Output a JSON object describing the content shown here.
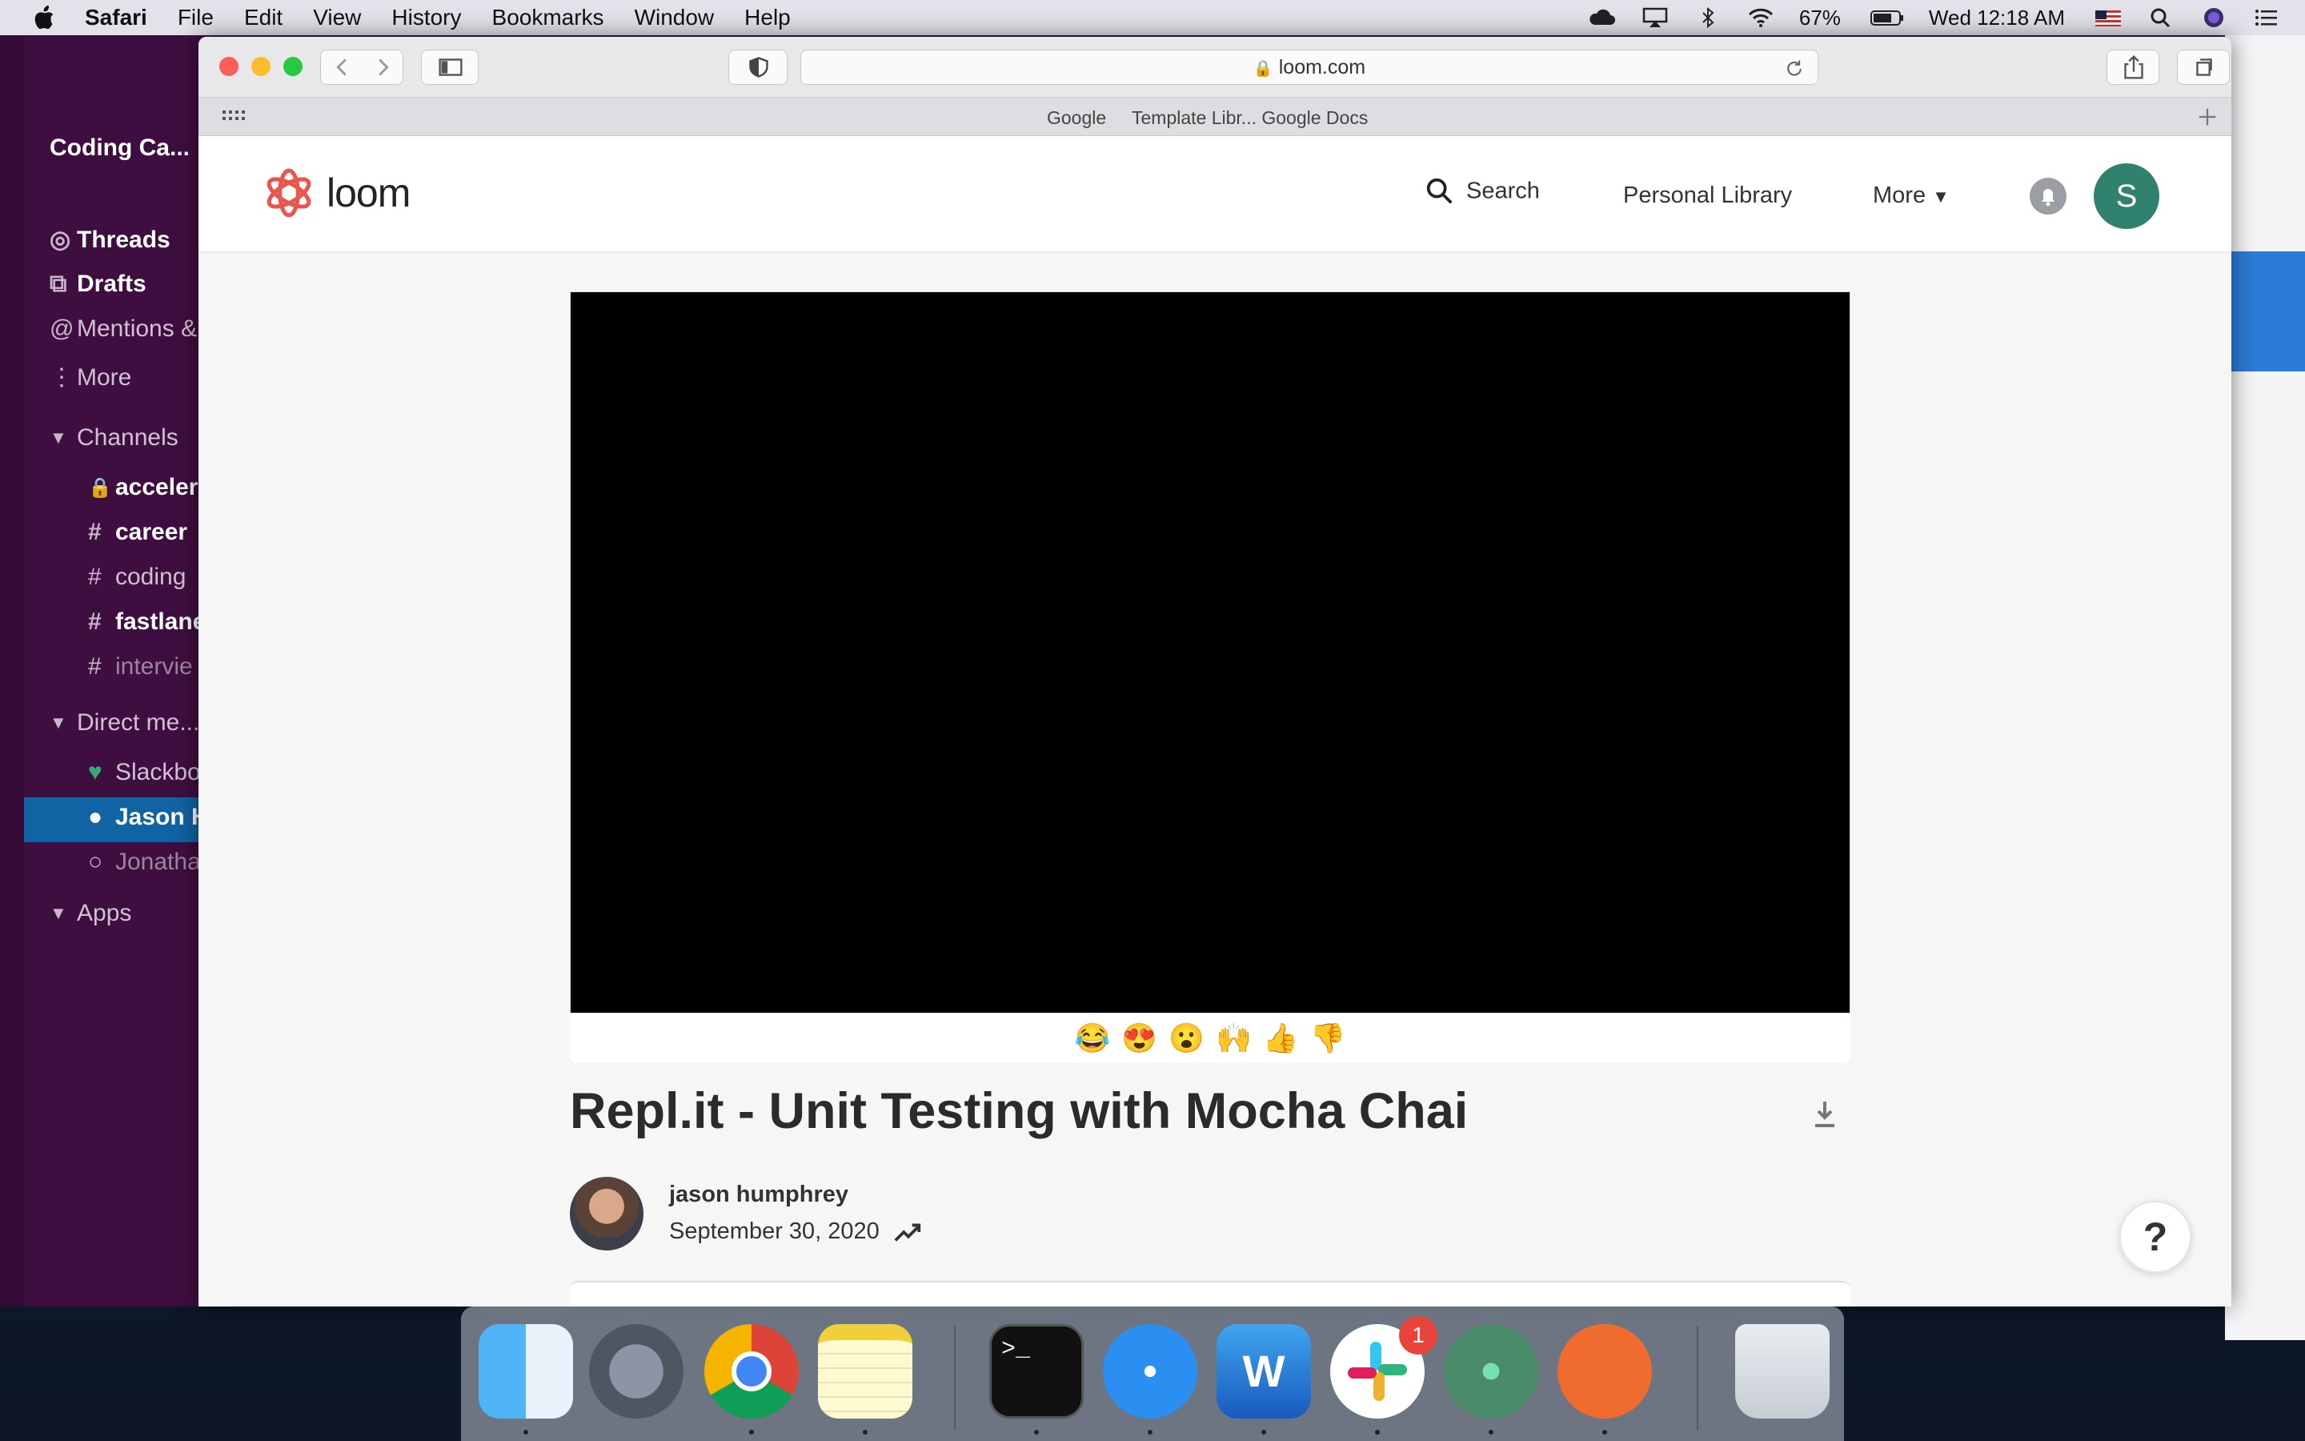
{
  "menubar": {
    "app": "Safari",
    "items": [
      "File",
      "Edit",
      "View",
      "History",
      "Bookmarks",
      "Window",
      "Help"
    ],
    "battery": "67%",
    "clock": "Wed 12:18 AM"
  },
  "slack": {
    "workspace": "Coding Ca...",
    "threads": "Threads",
    "drafts": "Drafts",
    "mentions": "Mentions &",
    "more": "More",
    "channels_header": "Channels",
    "channels": [
      "accelera",
      "career",
      "coding",
      "fastlane",
      "intervie"
    ],
    "dm_header": "Direct me...",
    "dms": [
      "Slackbo",
      "Jason H",
      "Jonatha"
    ],
    "apps_header": "Apps"
  },
  "safari": {
    "url": "loom.com",
    "favorites": [
      "Google",
      "Template Libr... Google Docs"
    ]
  },
  "loom": {
    "brand": "loom",
    "nav": {
      "search": "Search",
      "library": "Personal Library",
      "more": "More"
    },
    "avatar_initial": "S",
    "reactions": [
      "😂",
      "😍",
      "😮",
      "🙌",
      "👍",
      "👎"
    ],
    "video_title": "Repl.it - Unit Testing with Mocha Chai",
    "author": "jason humphrey",
    "date": "September 30, 2020",
    "help": "?"
  },
  "dock": {
    "apps": [
      "finder-icon",
      "launchpad-icon",
      "chrome-icon",
      "notes-icon",
      "terminal-icon",
      "safari-icon",
      "word-icon",
      "slack-icon",
      "atom-icon",
      "postman-icon",
      "trash-icon"
    ],
    "slack_badge": "1"
  },
  "colors": {
    "slack_bg": "#3f0e40",
    "slack_selected": "#1164a3",
    "loom_avatar": "#30826f",
    "loom_brand": "#e8564d"
  }
}
